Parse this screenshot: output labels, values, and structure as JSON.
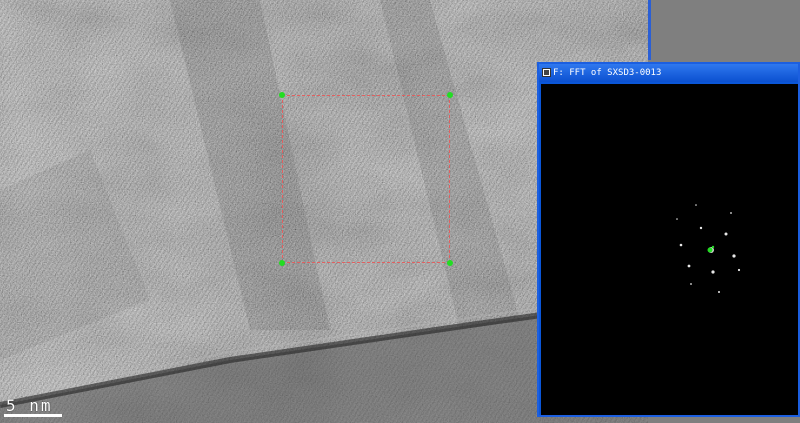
{
  "main_image": {
    "scale_bar_label": "5 nm"
  },
  "fft_window": {
    "title": "F: FFT of SXSD3-0013",
    "icon": "image-window-icon"
  },
  "colors": {
    "roi_dash": "#e06060",
    "roi_handle": "#22dd22",
    "window_title_blue": "#0b50d0",
    "fft_center": "#22dd22"
  }
}
